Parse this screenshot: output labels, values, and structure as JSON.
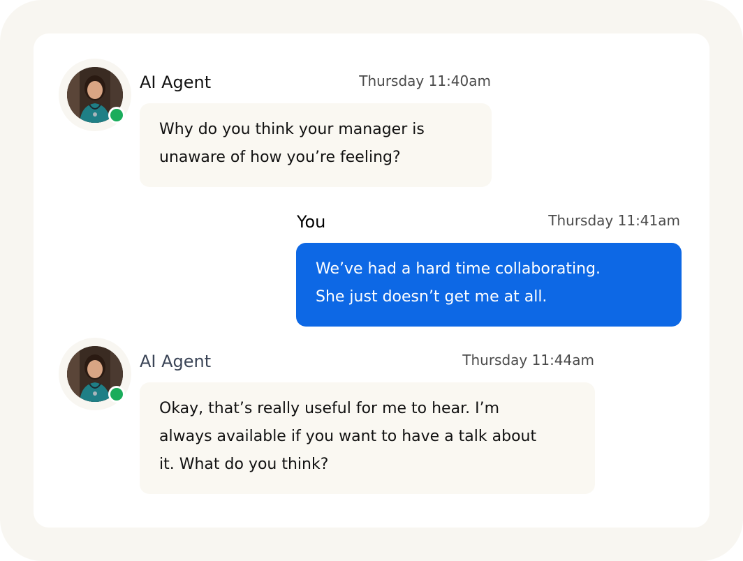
{
  "messages": [
    {
      "sender": "AI Agent",
      "time": "Thursday 11:40am",
      "lines": [
        "Why do you think your manager is",
        "unaware of how you’re feeling?"
      ],
      "online": true
    },
    {
      "sender": "You",
      "time": "Thursday 11:41am",
      "lines": [
        "We’ve had a hard time collaborating.",
        "She just doesn’t get me at all."
      ]
    },
    {
      "sender": "AI Agent",
      "time": "Thursday 11:44am",
      "lines": [
        "Okay, that’s really useful for me to hear. I’m",
        "always available if you want to have a talk about",
        "it. What do you think?"
      ],
      "online": true
    }
  ],
  "colors": {
    "outer_bg": "#f8f6f1",
    "card_bg": "#ffffff",
    "agent_bubble": "#faf8f2",
    "user_bubble": "#0d68e5",
    "online_dot": "#1aac5b",
    "agent_name_1": "#111111",
    "agent_name_2": "#3a4456"
  },
  "icons": {
    "avatar": "agent-avatar-photo",
    "status": "online-status-icon"
  }
}
